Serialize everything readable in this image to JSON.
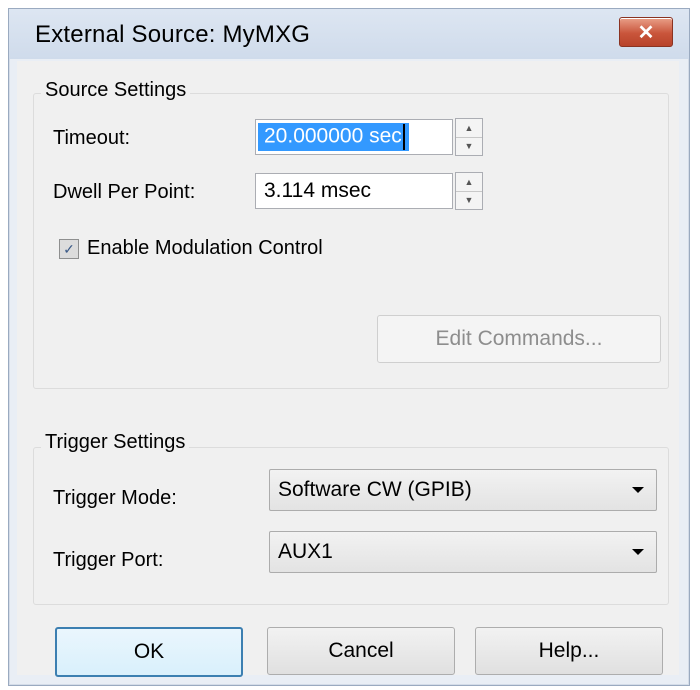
{
  "window": {
    "title": "External Source: MyMXG",
    "close_icon": "close-icon"
  },
  "source_settings": {
    "title": "Source Settings",
    "timeout_label": "Timeout:",
    "timeout_value": "20.000000 sec",
    "dwell_label": "Dwell Per Point:",
    "dwell_value": "3.114 msec",
    "modulation_label": "Enable Modulation Control",
    "modulation_checked": true,
    "edit_commands_label": "Edit Commands..."
  },
  "trigger_settings": {
    "title": "Trigger Settings",
    "mode_label": "Trigger Mode:",
    "mode_value": "Software CW (GPIB)",
    "port_label": "Trigger Port:",
    "port_value": "AUX1"
  },
  "buttons": {
    "ok": "OK",
    "cancel": "Cancel",
    "help": "Help..."
  },
  "colors": {
    "selection": "#3399ff",
    "close_button": "#c9553b",
    "titlebar": "#d5e0ee"
  }
}
